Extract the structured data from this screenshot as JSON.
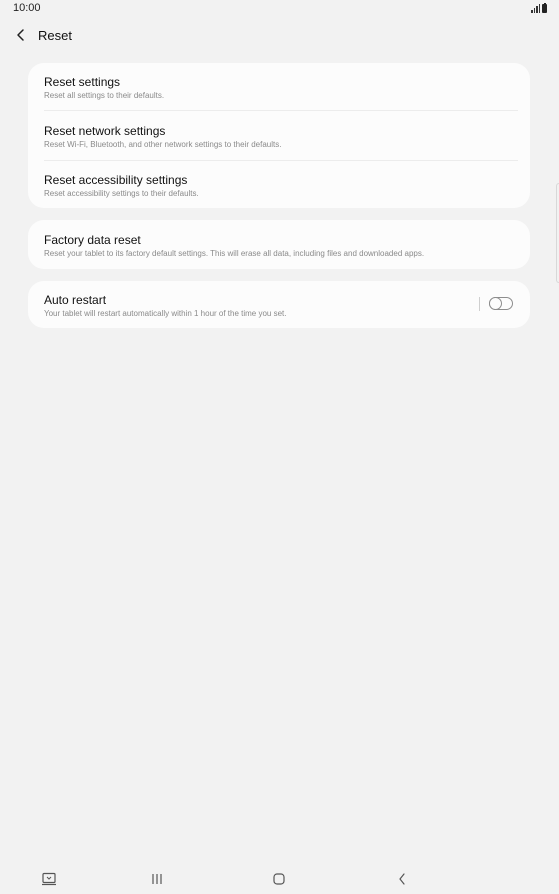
{
  "status_bar": {
    "time": "10:00",
    "icons": [
      "signal-icon",
      "battery-icon"
    ]
  },
  "header": {
    "back_icon": "chevron-left-icon",
    "title": "Reset"
  },
  "groups": [
    {
      "items": [
        {
          "title": "Reset settings",
          "subtitle": "Reset all settings to their defaults."
        },
        {
          "title": "Reset network settings",
          "subtitle": "Reset Wi-Fi, Bluetooth, and other network settings to their defaults."
        },
        {
          "title": "Reset accessibility settings",
          "subtitle": "Reset accessibility settings to their defaults."
        }
      ]
    },
    {
      "items": [
        {
          "title": "Factory data reset",
          "subtitle": "Reset your tablet to its factory default settings. This will erase all data, including files and downloaded apps."
        }
      ]
    },
    {
      "items": [
        {
          "title": "Auto restart",
          "subtitle": "Your tablet will restart automatically within 1 hour of the time you set.",
          "toggle": {
            "state": "off"
          }
        }
      ]
    }
  ],
  "nav_bar": {
    "buttons": [
      "keyboard-switch-icon",
      "recent-apps-icon",
      "home-icon",
      "back-icon"
    ]
  },
  "colors": {
    "background": "#f2f2f2",
    "card": "#fcfcfc",
    "subtitle": "#8a8a8a"
  }
}
